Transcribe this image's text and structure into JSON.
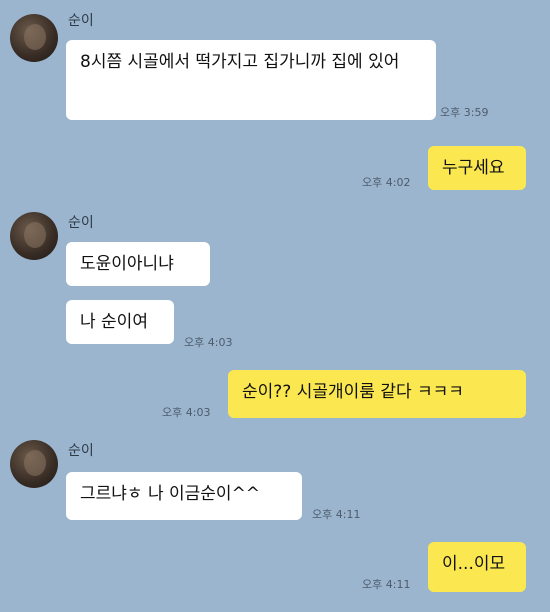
{
  "contact": {
    "name": "순이"
  },
  "messages": [
    {
      "side": "in",
      "text": "8시쯤 시골에서 떡가지고 집가니까 집에 있어",
      "time": "오후 3:59"
    },
    {
      "side": "out",
      "text": "누구세요",
      "time": "오후 4:02"
    },
    {
      "side": "in",
      "text": "도윤이아니냐",
      "time": ""
    },
    {
      "side": "in",
      "text": "나 순이여",
      "time": "오후 4:03"
    },
    {
      "side": "out",
      "text": "순이?? 시골개이룸 같다 ㅋㅋㅋ",
      "time": "오후 4:03"
    },
    {
      "side": "in",
      "text": "그르냐ㅎ 나 이금순이^^",
      "time": "오후 4:11"
    },
    {
      "side": "out",
      "text": "이...이모",
      "time": "오후 4:11"
    }
  ],
  "colors": {
    "background": "#9bb5cf",
    "incoming_bubble": "#ffffff",
    "outgoing_bubble": "#fbe850"
  }
}
